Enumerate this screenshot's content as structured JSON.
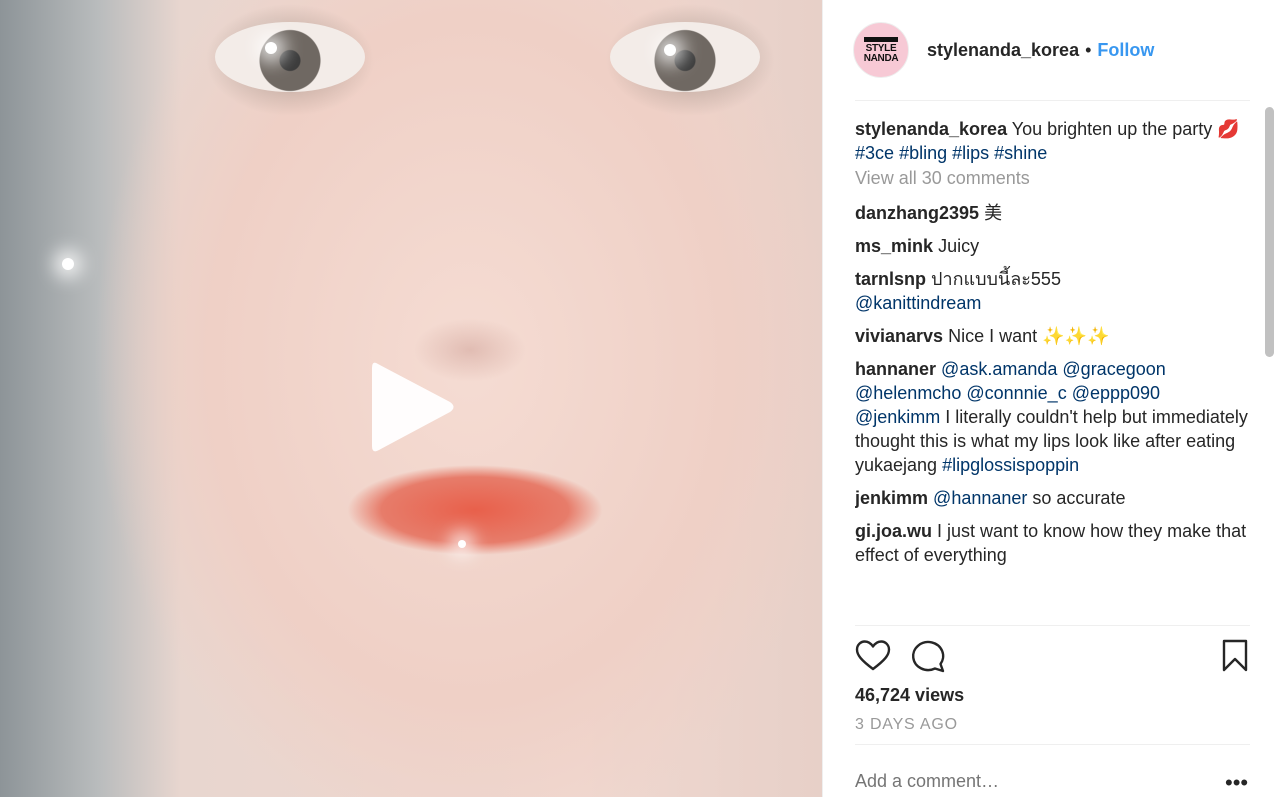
{
  "post": {
    "handle": "stylenanda_korea",
    "separator": "•",
    "follow_label": "Follow",
    "avatar_text": [
      "STYLE",
      "NANDA"
    ]
  },
  "caption": {
    "user": "stylenanda_korea",
    "text": "You brighten up the party 💋",
    "tags": [
      "#3ce",
      "#bling",
      "#lips",
      "#shine"
    ]
  },
  "view_all_label": "View all 30 comments",
  "comments": [
    {
      "user": "danzhang2395",
      "text": "美"
    },
    {
      "user": "ms_mink",
      "text": "Juicy"
    },
    {
      "user": "tarnlsnp",
      "text": "ปากแบบนี้ละ555",
      "after_mention": "@kanittindream"
    },
    {
      "user": "vivianarvs",
      "text": "Nice I want ✨✨✨"
    },
    {
      "user": "hannaner",
      "mentions": [
        "@ask.amanda",
        "@gracegoon",
        "@helenmcho",
        "@connnie_c",
        "@eppp090",
        "@jenkimm"
      ],
      "text": "I literally couldn't help but immediately thought this is what my lips look like after eating yukaejang",
      "tag": "#lipglossispoppin"
    },
    {
      "user": "jenkimm",
      "mention": "@hannaner",
      "text": "so accurate"
    },
    {
      "user": "gi.joa.wu",
      "text": "I just want to know how they make that effect of everything"
    }
  ],
  "stats": {
    "views": "46,724 views",
    "time_ago": "3 DAYS AGO"
  },
  "comment_box": {
    "placeholder": "Add a comment…",
    "more_label": "•••"
  },
  "icons": [
    "play-icon",
    "heart-icon",
    "comment-icon",
    "bookmark-icon",
    "more-options-icon"
  ],
  "colors": {
    "follow": "#3897f0",
    "mention": "#003569",
    "muted": "#999999",
    "avatar_bg": "#f7c9d5"
  }
}
